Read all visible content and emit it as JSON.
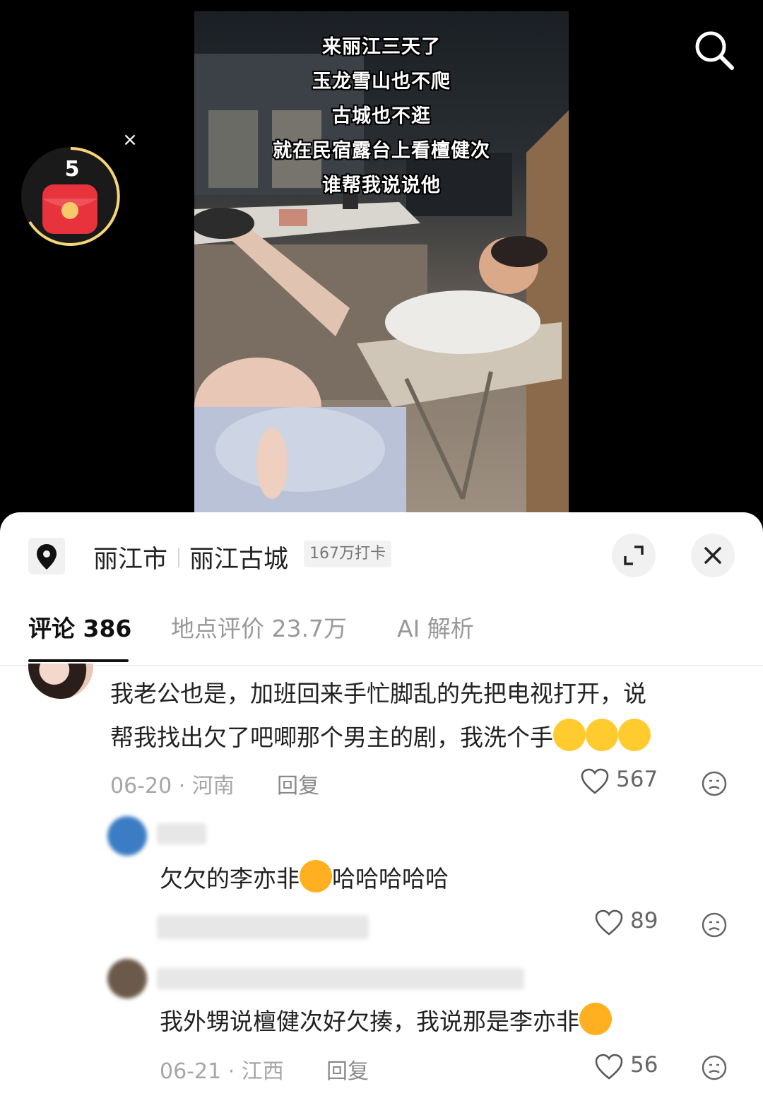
{
  "video": {
    "captions": [
      "来丽江三天了",
      "玉龙雪山也不爬",
      "古城也不逛",
      "就在民宿露台上看檀健次",
      "谁帮我说说他"
    ]
  },
  "overlay": {
    "redpacket_count": "5",
    "search_icon": "search-icon",
    "close_icon": "close-icon"
  },
  "location": {
    "city": "丽江市",
    "place": "丽江古城",
    "checkins": "167万打卡",
    "icon": "location-pin-icon"
  },
  "tabs": [
    {
      "label": "评论 386",
      "active": true
    },
    {
      "label": "地点评价 23.7万",
      "active": false
    },
    {
      "label": "AI 解析",
      "active": false
    }
  ],
  "comments": [
    {
      "text_line1": "我老公也是，加班回来手忙脚乱的先把电视打开，说",
      "text_line2": "帮我找出欠了吧唧那个男主的剧，我洗个手",
      "emojis": [
        "crying-laughing",
        "crying-laughing",
        "crying-laughing"
      ],
      "date": "06-20 · 河南",
      "reply_label": "回复",
      "likes": "567"
    },
    {
      "text_before_emoji": "欠欠的李亦非",
      "emoji": "laughing",
      "text_after_emoji": "哈哈哈哈哈",
      "likes": "89"
    },
    {
      "text": "我外甥说檀健次好欠揍，我说那是李亦非",
      "emoji": "rolling-laughing",
      "date": "06-21 · 江西",
      "reply_label": "回复",
      "likes": "56"
    }
  ],
  "colors": {
    "sheet_bg": "#ffffff",
    "text_primary": "#222222",
    "text_meta": "#a6a6a6",
    "redpacket": "#e8323c",
    "ring": "#f5d57a"
  }
}
